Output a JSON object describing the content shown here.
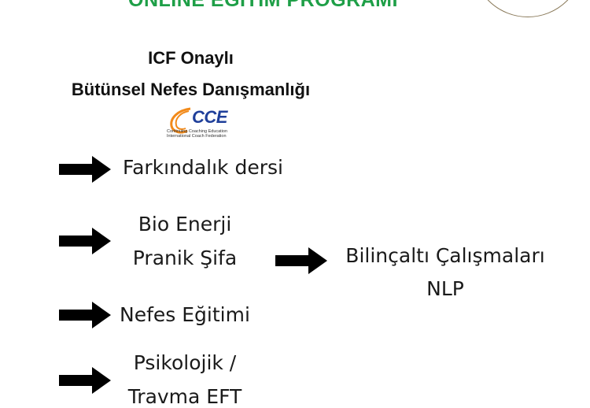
{
  "header": {
    "program_title": "ONLINE EĞİTİM PROGRAMI",
    "subtitle_line1": "ICF Onaylı",
    "subtitle_line2": "Bütünsel Nefes Danışmanlığı"
  },
  "logo": {
    "text": "CCE",
    "line1": "Continuing Coaching Education",
    "line2": "International Coach Federation",
    "colors": {
      "swoosh": "#f28a1a",
      "text": "#1f3f9a"
    }
  },
  "items": {
    "farkindalik": "Farkındalık dersi",
    "bio_line1": "Bio Enerji",
    "bio_line2": "Pranik Şifa",
    "bilincalti_line1": "Bilinçaltı Çalışmaları",
    "bilincalti_line2": "NLP",
    "nefes": "Nefes Eğitimi",
    "psikolojik_line1": "Psikolojik /",
    "psikolojik_line2": "Travma EFT"
  },
  "colors": {
    "title_green": "#1e9f47",
    "arrow": "#000000"
  }
}
